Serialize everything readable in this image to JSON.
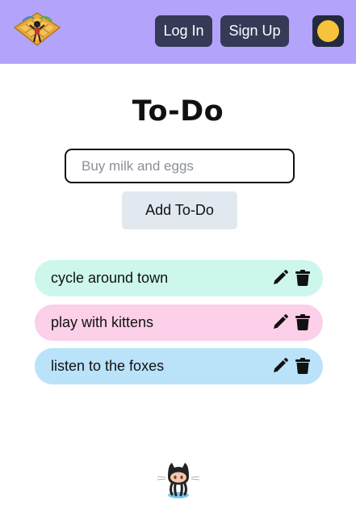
{
  "header": {
    "login_label": "Log In",
    "signup_label": "Sign Up",
    "logo_icon": "waffle-logo-icon",
    "theme_icon": "sun-icon",
    "colors": {
      "bar": "#b4a3fb",
      "button": "#363a57",
      "sun": "#f7c33b"
    }
  },
  "main": {
    "title": "To-Do",
    "input": {
      "placeholder": "Buy milk and eggs",
      "value": ""
    },
    "add_label": "Add To-Do"
  },
  "todos": [
    {
      "text": "cycle around town",
      "color": "#cdf7ec"
    },
    {
      "text": "play with kittens",
      "color": "#fbd0e8"
    },
    {
      "text": "listen to the foxes",
      "color": "#bae3fa"
    }
  ],
  "footer": {
    "icon": "github-octocat-icon"
  }
}
